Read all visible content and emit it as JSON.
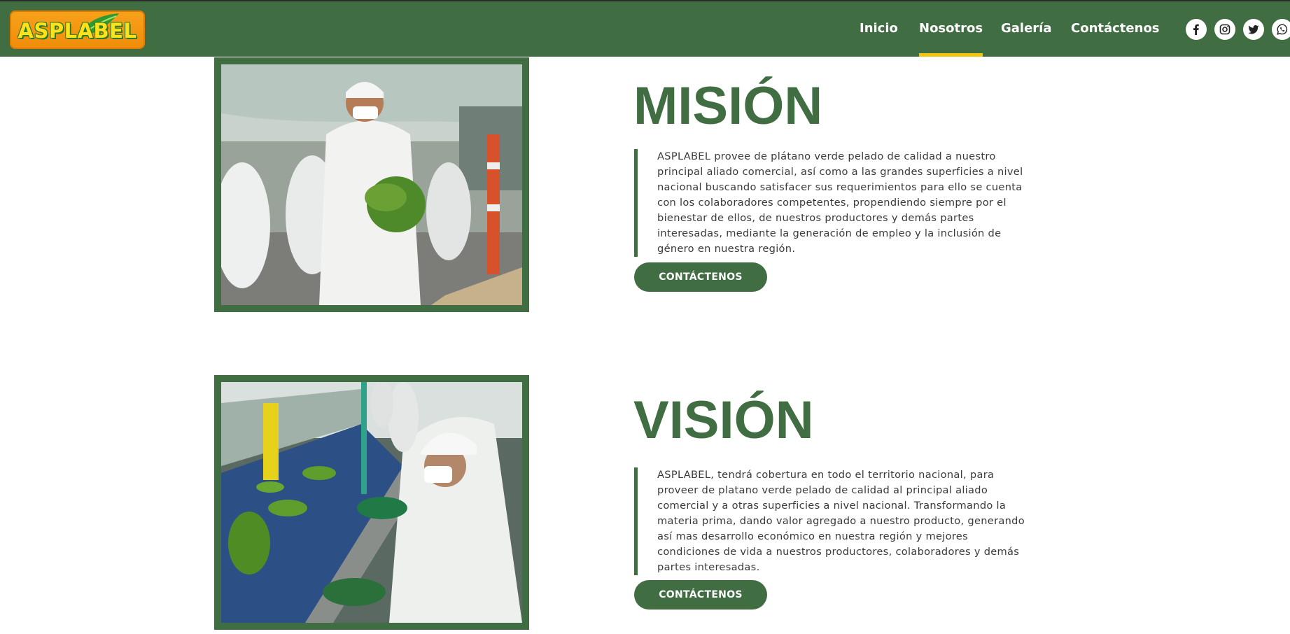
{
  "header": {
    "logo_text": "ASPLABEL",
    "nav": [
      {
        "label": "Inicio",
        "active": false
      },
      {
        "label": "Nosotros",
        "active": true
      },
      {
        "label": "Galería",
        "active": false
      },
      {
        "label": "Contáctenos",
        "active": false
      }
    ],
    "social": [
      "facebook-icon",
      "instagram-icon",
      "twitter-icon",
      "whatsapp-icon"
    ]
  },
  "mision": {
    "title": "MISIÓN",
    "text": "ASPLABEL provee de plátano verde pelado de calidad a nuestro principal aliado comercial, así como a las grandes superficies a nivel nacional buscando satisfacer sus requerimientos para ello se cuenta con los colaboradores competentes, propendiendo siempre por el bienestar de ellos, de nuestros productores y demás partes interesadas, mediante la generación de empleo y la inclusión de género en nuestra región.",
    "button": "CONTÁCTENOS"
  },
  "vision": {
    "title": "VISIÓN",
    "text": "ASPLABEL, tendrá cobertura en todo el territorio nacional, para proveer de platano verde pelado de calidad al principal aliado comercial y a otras superficies a nivel nacional. Transformando la materia prima, dando valor agregado a nuestro producto, generando así mas desarrollo económico en nuestra región y mejores condiciones de vida a nuestros productores, colaboradores y demás partes interesadas.",
    "button": "CONTÁCTENOS"
  },
  "colors": {
    "brand_green": "#416d42",
    "accent_yellow": "#f3c60e",
    "logo_orange": "#f7a21a"
  }
}
